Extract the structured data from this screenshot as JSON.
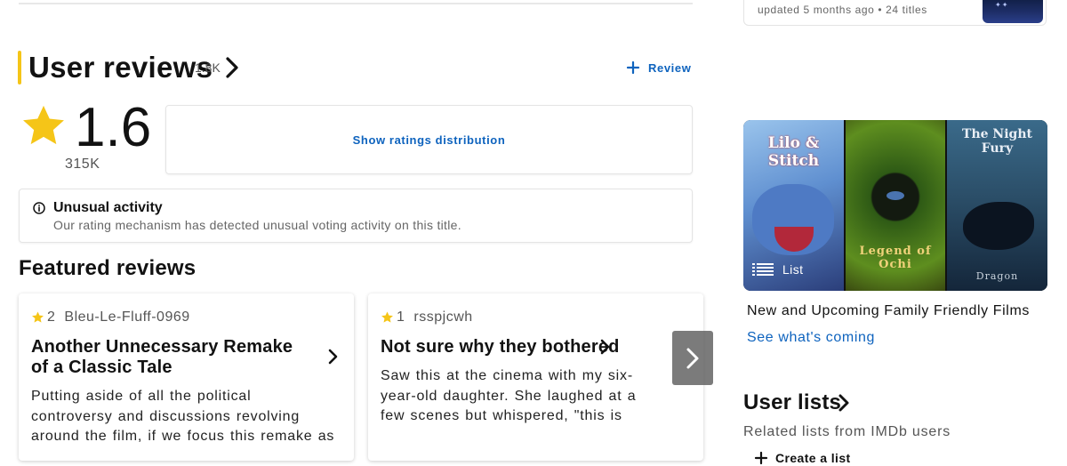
{
  "user_reviews": {
    "title": "User reviews",
    "count": "1.8K",
    "review_button": "Review",
    "rating": "1.6",
    "rating_count": "315K",
    "distribution_button": "Show ratings distribution"
  },
  "unusual_activity": {
    "title": "Unusual activity",
    "text": "Our rating mechanism has detected unusual voting activity on this title."
  },
  "featured_reviews": {
    "title": "Featured reviews",
    "cards": [
      {
        "rating": "2",
        "author": "Bleu-Le-Fluff-0969",
        "title": "Another Unnecessary Remake of a Classic Tale",
        "text": "Putting aside of all the political controversy and discussions revolving around the film, if we focus this remake as itself, still, it is really..."
      },
      {
        "rating": "1",
        "author": "rsspjcwh",
        "title": "Not sure why they bothered",
        "text": "Saw this at the cinema with my six-year-old daughter. She laughed at a few scenes but whispered, \"this is boring\" about forty five..."
      }
    ]
  },
  "sidebar": {
    "list_tile_meta": "updated 5 months ago • 24 titles",
    "promo": {
      "badge": "List",
      "posters": [
        {
          "title": "Lilo & Stitch"
        },
        {
          "title": "Legend of Ochi"
        },
        {
          "title": "The Night Fury",
          "subtitle": "Dragon"
        }
      ],
      "title": "New and Upcoming Family Friendly Films",
      "link": "See what's coming"
    },
    "user_lists": {
      "title": "User lists",
      "subtitle": "Related lists from IMDb users",
      "create_button": "Create a list"
    }
  },
  "colors": {
    "accent": "#f5c518",
    "link": "#0e63be",
    "text": "#121212"
  }
}
